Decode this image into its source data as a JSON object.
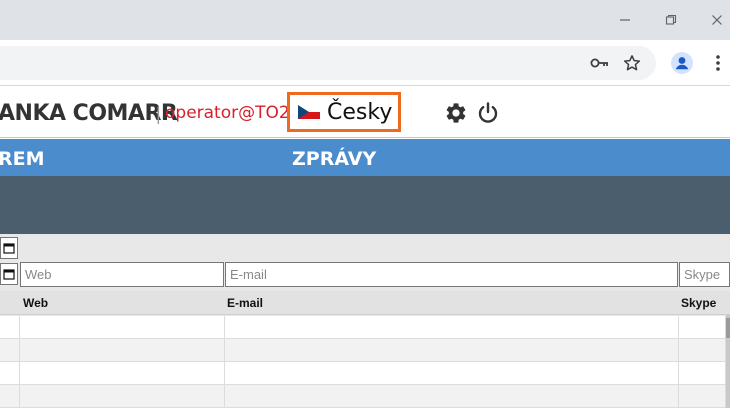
{
  "browser": {
    "window_controls": [
      "minimize",
      "restore",
      "close"
    ],
    "toolbar_icons": [
      "key-icon",
      "star-icon",
      "profile-icon",
      "menu-dots-icon"
    ]
  },
  "header": {
    "brand": "ANKA COMARR",
    "separator": "|",
    "operator": "operator@TO2",
    "language": "Česky"
  },
  "menu": {
    "items": [
      "REM",
      "ZPRÁVY"
    ]
  },
  "filters": {
    "web_placeholder": "Web",
    "email_placeholder": "E-mail",
    "skype_placeholder": "Skype"
  },
  "table": {
    "columns": [
      "Web",
      "E-mail",
      "Skype"
    ],
    "rows": [
      {
        "web": "",
        "email": "",
        "skype": ""
      },
      {
        "web": "",
        "email": "",
        "skype": ""
      },
      {
        "web": "",
        "email": "",
        "skype": ""
      },
      {
        "web": "",
        "email": "",
        "skype": ""
      }
    ]
  },
  "colors": {
    "menubar": "#4b8ccc",
    "darkband": "#4a5e6e",
    "operator": "#d8202a",
    "highlight": "#ee6a1f"
  }
}
